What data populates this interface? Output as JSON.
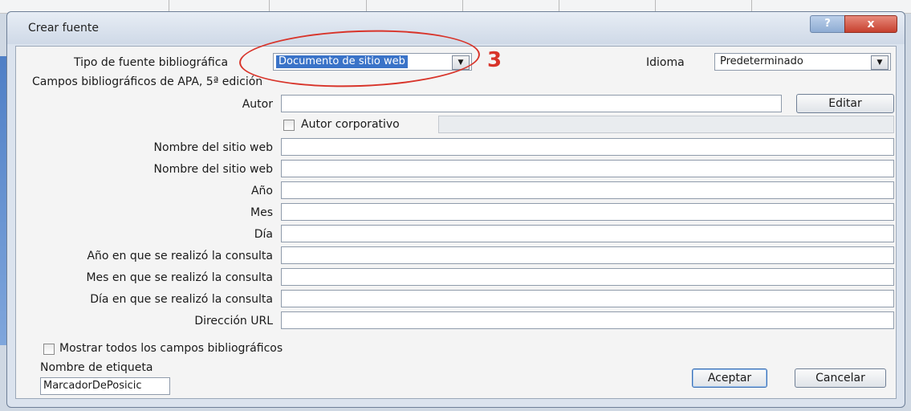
{
  "dialog": {
    "title": "Crear fuente",
    "help_label": "?",
    "close_label": "x"
  },
  "source_type": {
    "label": "Tipo de fuente bibliográfica",
    "value": "Documento de sitio web"
  },
  "language": {
    "label": "Idioma",
    "value": "Predeterminado"
  },
  "section_title": "Campos bibliográficos de APA, 5ª edición",
  "fields": {
    "author_label": "Autor",
    "author_value": "",
    "edit_button": "Editar",
    "corporate_author_label": "Autor corporativo",
    "corporate_author_value": "",
    "website_name_1_label": "Nombre del sitio web",
    "website_name_2_label": "Nombre del sitio web",
    "year_label": "Año",
    "month_label": "Mes",
    "day_label": "Día",
    "year_accessed_label": "Año en que se realizó la consulta",
    "month_accessed_label": "Mes en que se realizó la consulta",
    "day_accessed_label": "Día en que se realizó la consulta",
    "url_label": "Dirección URL"
  },
  "show_all": {
    "label": "Mostrar todos los campos bibliográficos"
  },
  "tag_name": {
    "label": "Nombre de etiqueta",
    "value": "MarcadorDePosicic"
  },
  "buttons": {
    "accept": "Aceptar",
    "cancel": "Cancelar"
  },
  "annotation": {
    "number": "3",
    "color": "#d8342a"
  }
}
